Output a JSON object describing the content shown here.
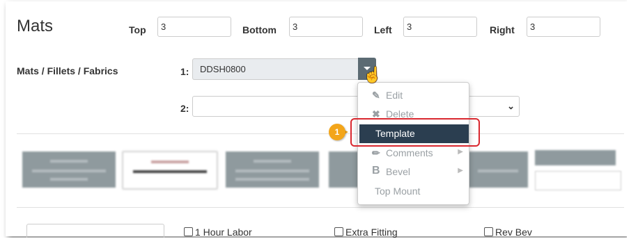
{
  "section": {
    "title": "Mats"
  },
  "margins": {
    "top_label": "Top",
    "top_value": "3",
    "bottom_label": "Bottom",
    "bottom_value": "3",
    "left_label": "Left",
    "left_value": "3",
    "right_label": "Right",
    "right_value": "3"
  },
  "mats": {
    "label": "Mats / Fillets / Fabrics",
    "row1_label": "1:",
    "row1_value": "DDSH0800",
    "row2_label": "2:",
    "row2_value": ""
  },
  "context_menu": {
    "items": [
      {
        "label": "Edit",
        "icon": "edit-icon"
      },
      {
        "label": "Delete",
        "icon": "delete-icon"
      },
      {
        "label": "Template",
        "icon": ""
      },
      {
        "label": "Comments",
        "icon": "pencil-icon"
      },
      {
        "label": "Bevel",
        "icon": "bold-b-icon"
      },
      {
        "label": "Top Mount",
        "icon": ""
      }
    ]
  },
  "annotation": {
    "badge": "1",
    "highlight_color": "#d9272e",
    "badge_color": "#f3a51a"
  },
  "options": {
    "checkbox1": "1 Hour Labor",
    "checkbox2": "Extra Fitting",
    "checkbox3": "Rev Bev"
  },
  "colors": {
    "menu_active_bg": "#2b3e50",
    "dropdown_btn": "#5c6b73"
  }
}
